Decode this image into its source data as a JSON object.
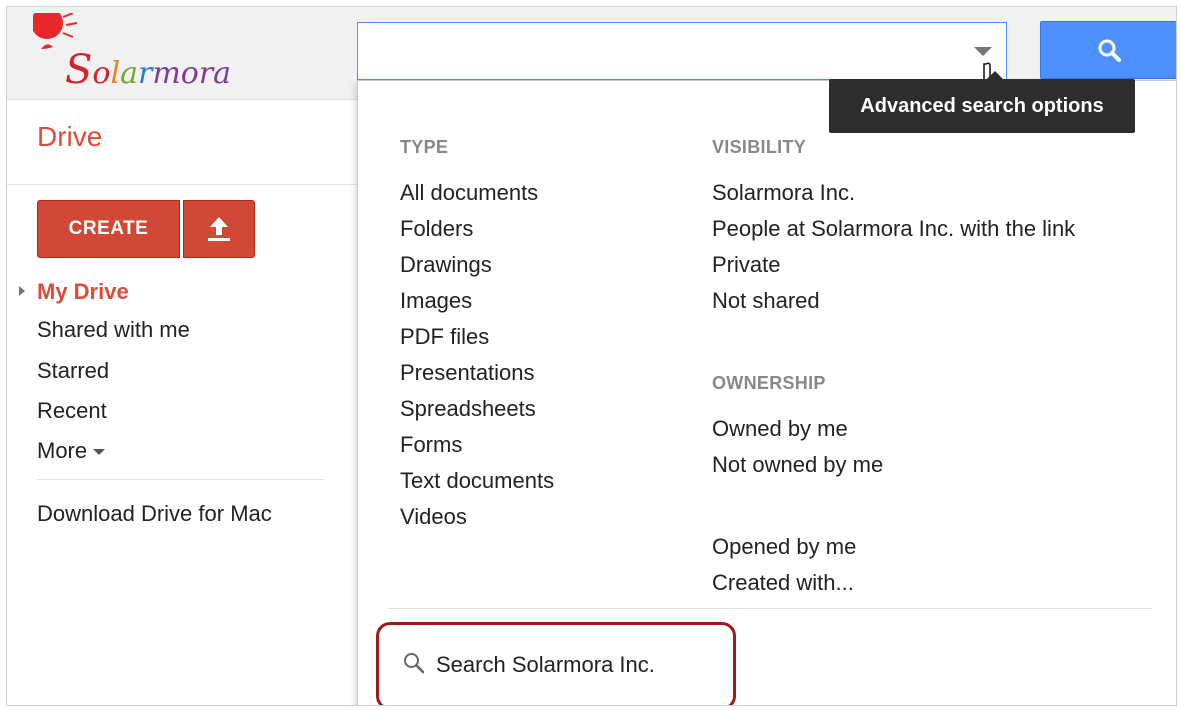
{
  "logo": {
    "text": "Solarmora"
  },
  "search": {
    "value": "",
    "placeholder": "",
    "advanced_tooltip": "Advanced search options"
  },
  "sidebar": {
    "title": "Drive",
    "create_label": "CREATE",
    "nav": [
      {
        "label": "My Drive",
        "active": true
      },
      {
        "label": "Shared with me"
      },
      {
        "label": "Starred"
      },
      {
        "label": "Recent"
      },
      {
        "label": "More"
      }
    ],
    "download_link": "Download Drive for Mac"
  },
  "dropdown": {
    "type_heading": "TYPE",
    "type_options": [
      "All documents",
      "Folders",
      "Drawings",
      "Images",
      "PDF files",
      "Presentations",
      "Spreadsheets",
      "Forms",
      "Text documents",
      "Videos"
    ],
    "visibility_heading": "VISIBILITY",
    "visibility_options": [
      "Solarmora Inc.",
      "People at Solarmora Inc. with the link",
      "Private",
      "Not shared"
    ],
    "ownership_heading": "OWNERSHIP",
    "ownership_options": [
      "Owned by me",
      "Not owned by me"
    ],
    "other_options": [
      "Opened by me",
      "Created with..."
    ],
    "search_org": "Search Solarmora Inc."
  },
  "colors": {
    "accent_red": "#dd4b39",
    "button_red": "#d14836",
    "search_blue": "#4d90fe",
    "highlight_border": "#9b1b1b"
  }
}
